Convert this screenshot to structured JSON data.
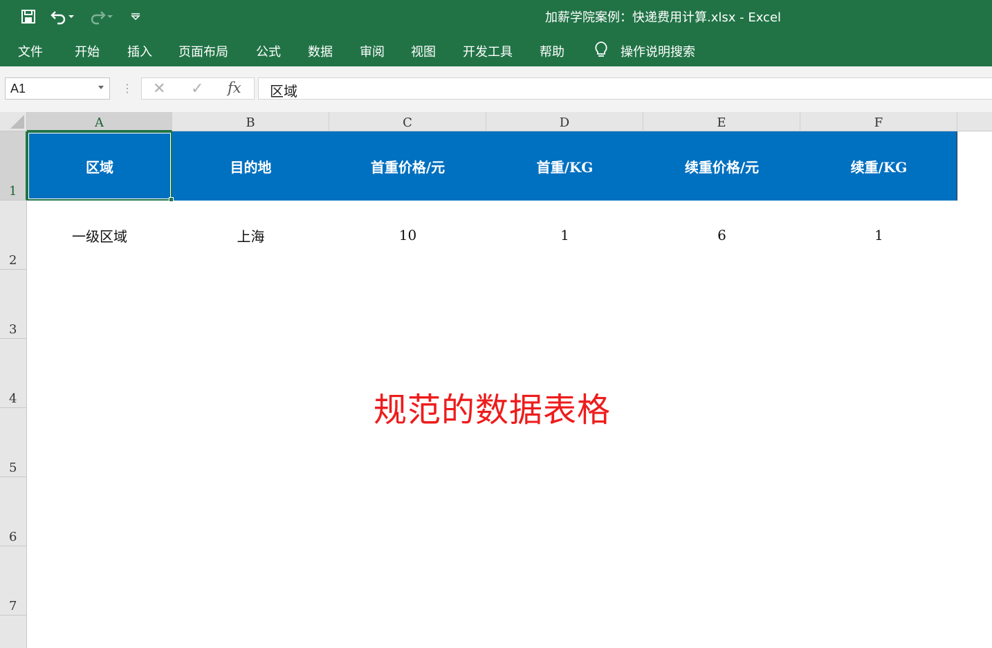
{
  "titlebar": {
    "title": "加薪学院案例：快递费用计算.xlsx  -  Excel",
    "icons": [
      "save-icon",
      "undo-icon",
      "redo-icon",
      "customize-qat-icon"
    ],
    "accent_color": "#217346"
  },
  "ribbon": {
    "tabs": [
      "文件",
      "开始",
      "插入",
      "页面布局",
      "公式",
      "数据",
      "审阅",
      "视图",
      "开发工具",
      "帮助"
    ],
    "tell_me": "操作说明搜索"
  },
  "formula_bar": {
    "name_box": "A1",
    "formula": "区域",
    "fx_label": "fx"
  },
  "sheet": {
    "columns": [
      "A",
      "B",
      "C",
      "D",
      "E",
      "F"
    ],
    "rows": [
      "1",
      "2",
      "3",
      "4",
      "5",
      "6",
      "7"
    ],
    "header_row": [
      "区域",
      "目的地",
      "首重价格/元",
      "首重/KG",
      "续重价格/元",
      "续重/KG"
    ],
    "data_row": [
      "一级区域",
      "上海",
      "10",
      "1",
      "6",
      "1"
    ],
    "header_fill": "#0070c0",
    "selected_cell": "A1"
  },
  "annotation": {
    "text": "规范的数据表格",
    "color": "#ee1c1c"
  }
}
